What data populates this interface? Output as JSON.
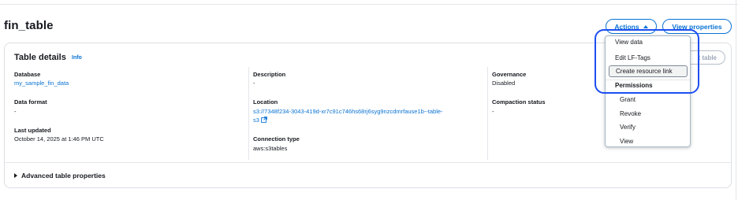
{
  "header": {
    "title": "fin_table",
    "actions_label": "Actions",
    "view_properties_label": "View properties"
  },
  "details": {
    "title": "Table details",
    "info_label": "Info",
    "edit_table_label": "t table",
    "database_label": "Database",
    "database_value": "my_sample_fin_data",
    "data_format_label": "Data format",
    "data_format_value": "-",
    "last_updated_label": "Last updated",
    "last_updated_value": "October 14, 2025 at 1:46 PM UTC",
    "description_label": "Description",
    "description_value": "-",
    "location_label": "Location",
    "location_line1": "s3://7348f234-3043-419d-xr7c91c746hs68rj6syg9nzcdmrfause1b--table-",
    "location_line2": "s3",
    "connection_type_label": "Connection type",
    "connection_type_value": "aws:s3tables",
    "governance_label": "Governance",
    "governance_value": "Disabled",
    "compaction_label": "Compaction status",
    "compaction_value": "-"
  },
  "advanced": {
    "label": "Advanced table properties"
  },
  "actions_menu": {
    "items": [
      {
        "label": "View data"
      },
      {
        "label": "Edit LF-Tags"
      },
      {
        "label": "Create resource link"
      }
    ],
    "group_header": "Permissions",
    "sub_items": [
      {
        "label": "Grant"
      },
      {
        "label": "Revoke"
      },
      {
        "label": "Verify"
      },
      {
        "label": "View"
      }
    ]
  },
  "colors": {
    "accent": "#0972d3",
    "highlight_box": "#1d4ef2",
    "text": "#16191f",
    "border": "#dcdfe3"
  },
  "icons": {
    "actions_caret": "caret-up-icon",
    "external_link": "external-link-icon",
    "expand": "caret-right-icon"
  }
}
